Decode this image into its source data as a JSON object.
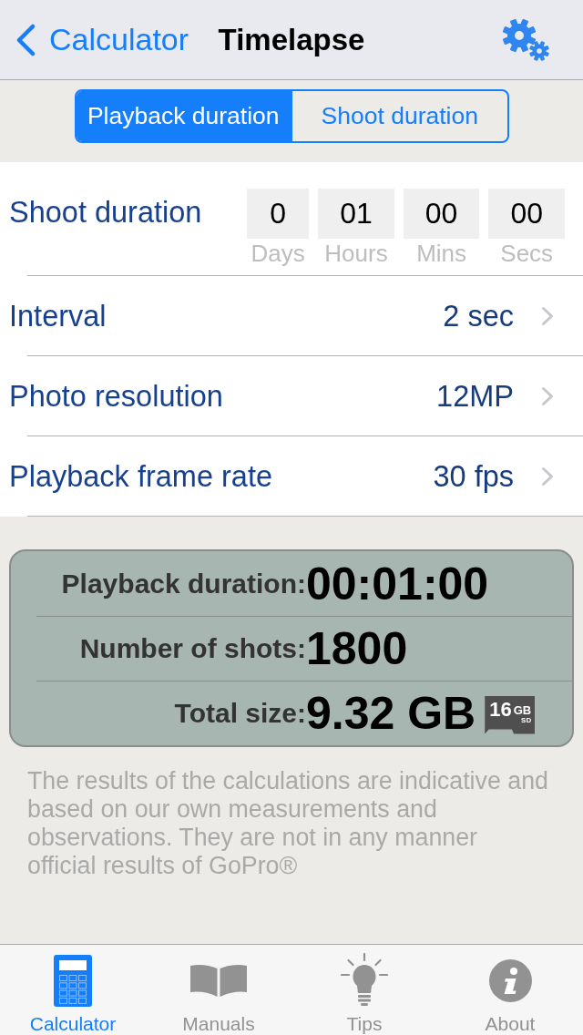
{
  "nav": {
    "back": "Calculator",
    "title": "Timelapse"
  },
  "segments": [
    {
      "label": "Playback duration",
      "selected": true
    },
    {
      "label": "Shoot duration",
      "selected": false
    }
  ],
  "shoot_duration": {
    "label": "Shoot duration",
    "fields": [
      {
        "value": "0",
        "unit": "Days"
      },
      {
        "value": "01",
        "unit": "Hours"
      },
      {
        "value": "00",
        "unit": "Mins"
      },
      {
        "value": "00",
        "unit": "Secs"
      }
    ]
  },
  "settings": [
    {
      "label": "Interval",
      "value": "2 sec"
    },
    {
      "label": "Photo resolution",
      "value": "12MP"
    },
    {
      "label": "Playback frame rate",
      "value": "30 fps"
    }
  ],
  "results": [
    {
      "label": "Playback duration:",
      "value": "00:01:00"
    },
    {
      "label": "Number of shots:",
      "value": "1800"
    },
    {
      "label": "Total size:",
      "value": "9.32 GB",
      "sd_card": {
        "capacity": "16",
        "unit": "GB",
        "format": "SD"
      }
    }
  ],
  "disclaimer": "The results of the calculations are indicative and based on our own measurements and observations. They are not in any manner official results of GoPro®",
  "tabs": [
    {
      "label": "Calculator",
      "kind": "calculator",
      "selected": true
    },
    {
      "label": "Manuals",
      "kind": "book",
      "selected": false
    },
    {
      "label": "Tips",
      "kind": "lightbulb",
      "selected": false
    },
    {
      "label": "About",
      "kind": "info",
      "selected": false
    }
  ]
}
